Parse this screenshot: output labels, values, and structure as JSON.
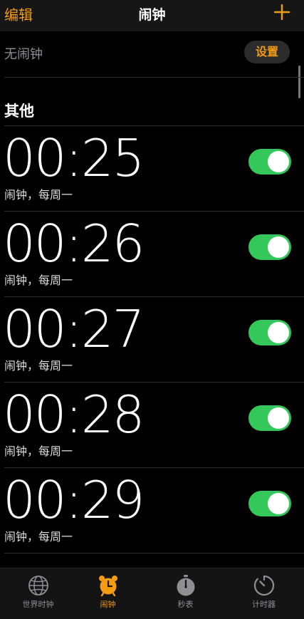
{
  "nav": {
    "edit": "编辑",
    "title": "闹钟"
  },
  "bedtime": {
    "label": "无闹钟",
    "button": "设置"
  },
  "section_title": "其他",
  "alarms": [
    {
      "time": "00:25",
      "label": "闹钟，每周一",
      "enabled": true
    },
    {
      "time": "00:26",
      "label": "闹钟，每周一",
      "enabled": true
    },
    {
      "time": "00:27",
      "label": "闹钟，每周一",
      "enabled": true
    },
    {
      "time": "00:28",
      "label": "闹钟，每周一",
      "enabled": true
    },
    {
      "time": "00:29",
      "label": "闹钟，每周一",
      "enabled": true
    }
  ],
  "tabs": [
    {
      "label": "世界时钟",
      "icon": "globe-icon",
      "active": false
    },
    {
      "label": "闹钟",
      "icon": "alarm-clock-icon",
      "active": true
    },
    {
      "label": "秒表",
      "icon": "stopwatch-icon",
      "active": false
    },
    {
      "label": "计时器",
      "icon": "timer-icon",
      "active": false
    }
  ],
  "colors": {
    "accent": "#f39c12",
    "toggle_on": "#34c759",
    "background": "#000000"
  }
}
